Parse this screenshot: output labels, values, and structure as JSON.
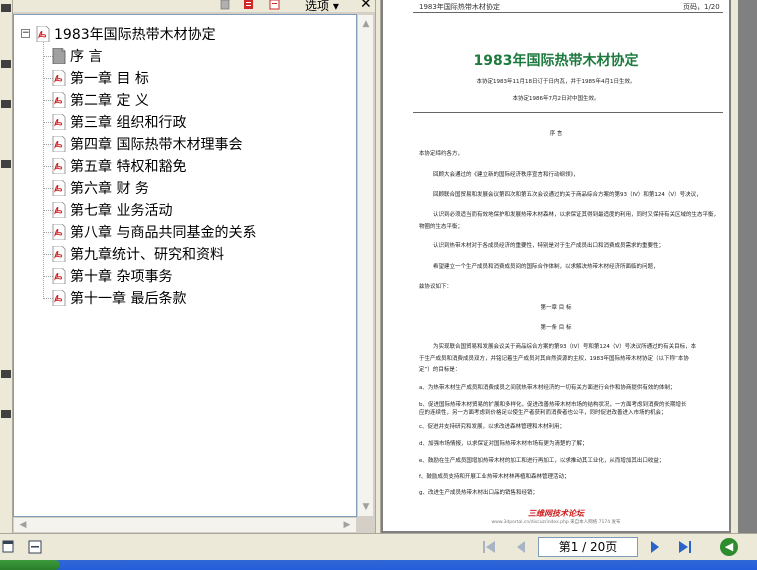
{
  "toolbar": {
    "options_label": "选项 ▾",
    "close_label": "✕"
  },
  "bookmarks": {
    "root": "1983年国际热带木材协定",
    "items": [
      "序 言",
      "第一章 目 标",
      "第二章 定 义",
      "第三章 组织和行政",
      "第四章 国际热带木材理事会",
      "第五章 特权和豁免",
      "第六章 财 务",
      "第七章 业务活动",
      "第八章 与商品共同基金的关系",
      "第九章统计、研究和资料",
      "第十章 杂项事务",
      "第十一章 最后条款"
    ]
  },
  "document": {
    "header_left": "1983年国际热带木材协定",
    "header_right": "页码，1/20",
    "title": "1983年国际热带木材协定",
    "subtitle1": "本协定1983年11月18日订于日内瓦，并于1985年4月1日生效。",
    "subtitle2": "本协定1986年7月2日对中国生效。",
    "preface_heading": "序 言",
    "preface_lines": [
      "本协定缔约各方，",
      "回顾大会通过的《建立新的国际经济秩序宣言和行动纲领》，",
      "回顾联合国贸易和发展会议第四次和第五次会议通过的关于商品综合方案的第93（IV）和第124（V）号决议，",
      "认识到必须适当而有效地保护和发展热带木材森林，以求保证其得到最适度的利用，同时又保持有关区域的生态平衡，",
      "物圈的生态平衡；",
      "认识到热带木材对于各成员经济的重要性，特别是对于生产成员出口和消费成员需求的重要性；",
      "希望建立一个生产成员和消费成员间的国际合作体制，以求解决热带木材经济所面临的问题，",
      "兹协议如下："
    ],
    "chapter1_heading": "第一章 目 标",
    "article1_heading": "第一条 目 标",
    "article1_lines": [
      "为实现联合国贸易和发展会议关于商品综合方案的第93（IV）号和第124（V）号决议所通过的有关目标，本",
      "于生产成员和消费成员双方，并铭记着生产成员对其自然资源的主权，1983年国际热带木材协定（以下称“本协",
      "定”）的目标是：",
      "a、为热带木材生产成员和消费成员之间就热带木材经济的一切有关方面进行合作和协商提供有效的体制；",
      "b、促进国际热带木材贸易的扩展和多样化，促进改善热带木材市场的结构状况，一方面考虑到消费的长期增长",
      "应的连续性，另一方面考虑到价格足以使生产者获利而消费者也公平，同时促进改善进入市场的机会；",
      "c、促进并支持研究和发展，以求改进森林管理和木材利用；",
      "d、加强市场情报，以求保证对国际热带木材市场有更为清楚的了解；",
      "e、鼓励在生产成员国增加热带木材的加工和进行再加工，以求推动其工业化，从而增加其出口收益；",
      "f、鼓励成员支持和开展工业热带木材林再植和森林管理活动；",
      "g、改进生产成员热带木材出口品的销售和经销；"
    ],
    "watermark": "三维网技术论坛",
    "watermark_sub": "www.3dportal.cn/discuz/index.php  来自本人网络 7174  发布"
  },
  "nav": {
    "page_indicator": "第1 / 20页"
  }
}
